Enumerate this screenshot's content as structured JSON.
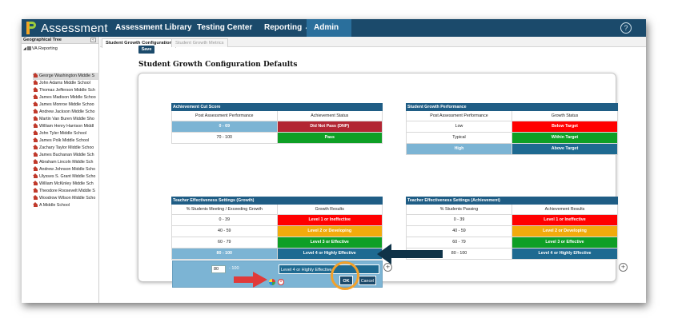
{
  "app": {
    "title": "Assessment"
  },
  "nav": {
    "items": [
      {
        "label": "Assessment Library"
      },
      {
        "label": "Testing Center"
      },
      {
        "label": "Reporting ⌄"
      },
      {
        "label": "Admin ⌄"
      }
    ],
    "help_icon": "?"
  },
  "left_panel": {
    "title": "Geographical Tree",
    "collapse": "«",
    "root": "VA Reporting",
    "schools": [
      "George Washington Middle S",
      "John Adams Middle School",
      "Thomas Jefferson Middle Sch",
      "James Madison Middle Schoo",
      "James Monroe Middle Schoo",
      "Andrew Jackson Middle Scho",
      "Martin Van Buren Middle Sho",
      "William Henry Harrison Middl",
      "John Tyler Middle School",
      "James Polk Middle School",
      "Zachary Taylor Middle Schoo",
      "James Buchanan Middle Sch",
      "Abraham Lincoln Middle Sch",
      "Andrew Johnson Middle Scho",
      "Ulysses S. Grant Middle Scho",
      "William McKinley Middle Sch",
      "Theodore Roosevelt Middle S",
      "Woodrow Wilson Middle Scho",
      "A Middle School"
    ],
    "selected_index": 0
  },
  "tabs": [
    {
      "label": "Student Growth Configuration",
      "active": true
    },
    {
      "label": "Student Growth Metrics",
      "active": false
    }
  ],
  "save_label": "Save",
  "page_title": "Student Growth Configuration Defaults",
  "achievement_cut": {
    "title": "Achievement Cut Score",
    "headers": [
      "Post Assessment Performance",
      "Achievement Status"
    ],
    "rows": [
      {
        "range": "0 - 69",
        "status": "Did Not Pass (DNP)"
      },
      {
        "range": "70 - 100",
        "status": "Pass"
      }
    ]
  },
  "growth_performance": {
    "title": "Student Growth Performance",
    "headers": [
      "Post Assessment Performance",
      "Growth Status"
    ],
    "rows": [
      {
        "level": "Low",
        "status": "Below Target"
      },
      {
        "level": "Typical",
        "status": "Within Target"
      },
      {
        "level": "High",
        "status": "Above Target"
      }
    ]
  },
  "teacher_growth": {
    "title": "Teacher Effectiveness Settings (Growth)",
    "headers": [
      "% Students Meeting / Exceeding Growth",
      "Growth Results"
    ],
    "rows": [
      {
        "range": "0 - 39",
        "result": "Level 1 or Ineffective"
      },
      {
        "range": "40 - 59",
        "result": "Level 2 or Developing"
      },
      {
        "range": "60 - 79",
        "result": "Level 3 or Effective"
      },
      {
        "range": "80 - 100",
        "result": "Level 4 or Highly Effective"
      }
    ]
  },
  "teacher_achievement": {
    "title": "Teacher Effectiveness Settings (Achievement)",
    "headers": [
      "% Students Passing",
      "Achievement Results"
    ],
    "rows": [
      {
        "range": "0 - 39",
        "result": "Level 1 or Ineffective"
      },
      {
        "range": "40 - 59",
        "result": "Level 2 or Developing"
      },
      {
        "range": "60 - 79",
        "result": "Level 3 or Effective"
      },
      {
        "range": "80 - 100",
        "result": "Level 4 or Highly Effective"
      }
    ]
  },
  "edit_row": {
    "from_value": "80",
    "to_value": "- 100",
    "result_value": "Level 4 or Highly Effective",
    "ok_label": "OK",
    "cancel_label": "Cancel"
  },
  "add_icon": "+",
  "colors": {
    "nav_bg": "#1b4a6b",
    "table_header": "#1f5d85",
    "highlight_row": "#7cb4d4",
    "red": "#ff0000",
    "dark_red": "#b22633",
    "green": "#0e9f25",
    "orange": "#f2ab0c",
    "blue": "#1e6a91",
    "annotation_arrow_red": "#e03a3a",
    "annotation_arrow_navy": "#0f3348",
    "annotation_circle": "#f2a12b"
  }
}
